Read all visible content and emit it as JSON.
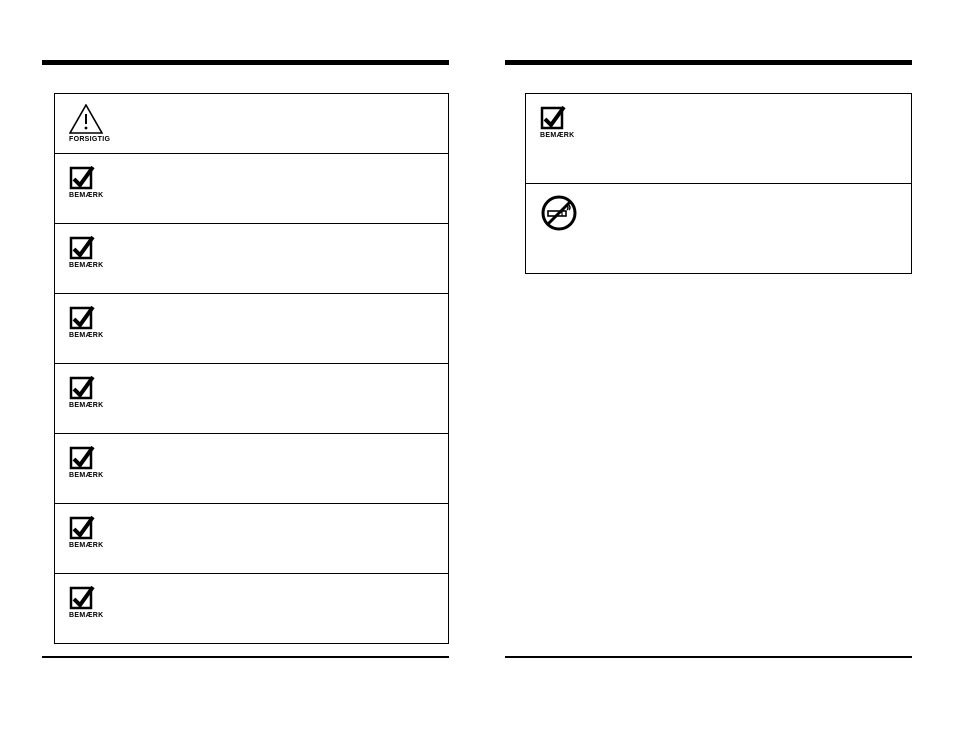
{
  "icons": {
    "caution_caption": "FORSIGTIG",
    "note_caption": "BEMÆRK"
  },
  "left_column": {
    "cells": [
      {
        "icon": "caution",
        "text": ""
      },
      {
        "icon": "note",
        "text": ""
      },
      {
        "icon": "note",
        "text": ""
      },
      {
        "icon": "note",
        "text": ""
      },
      {
        "icon": "note",
        "text": ""
      },
      {
        "icon": "note",
        "text": ""
      },
      {
        "icon": "note",
        "text": ""
      },
      {
        "icon": "note",
        "text": ""
      }
    ]
  },
  "right_column": {
    "cells": [
      {
        "icon": "note",
        "text": ""
      },
      {
        "icon": "nosmoking",
        "text": ""
      }
    ]
  }
}
